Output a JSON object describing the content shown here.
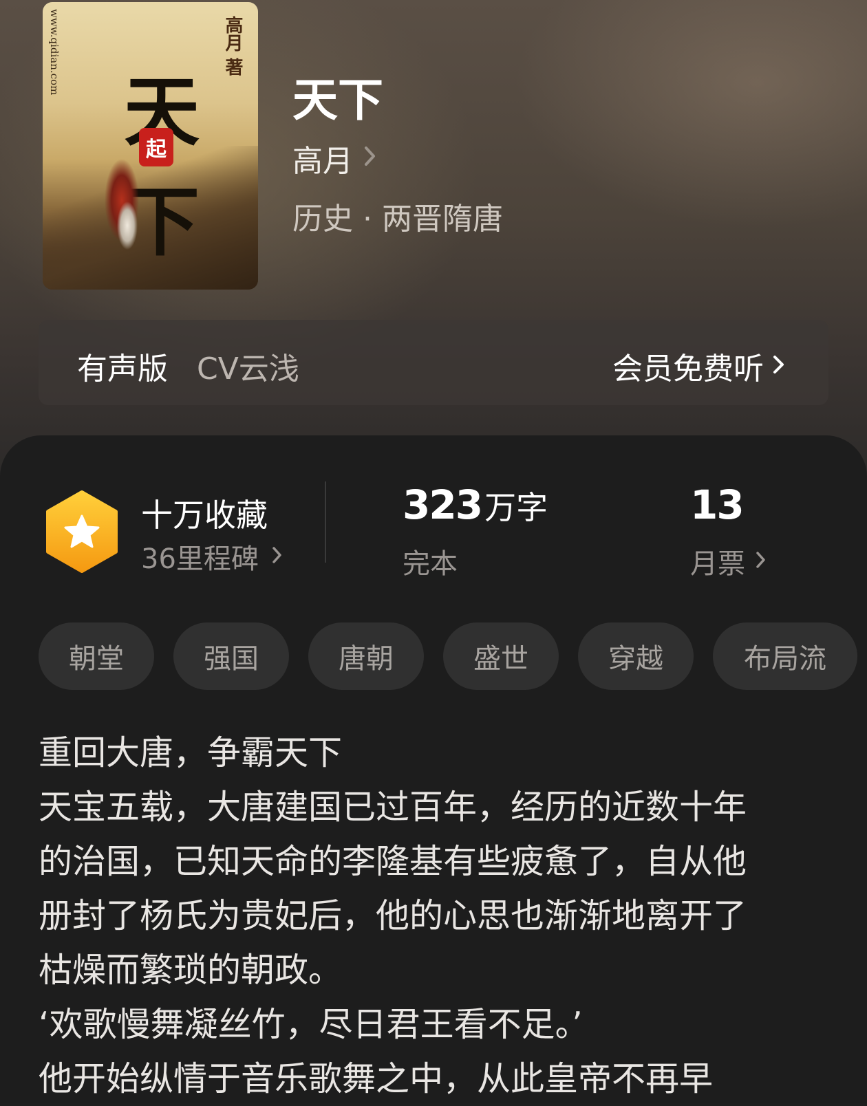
{
  "book": {
    "title": "天下",
    "author": "高月",
    "genre": "历史 · 两晋隋唐"
  },
  "cover": {
    "title": "天下",
    "author_signature": "高月 著",
    "seal": "起",
    "side_text": "www.qidian.com"
  },
  "audio": {
    "label": "有声版",
    "narrator": "CV云浅",
    "action": "会员免费听"
  },
  "stats": {
    "collect_title": "十万收藏",
    "milestone": "36里程碑",
    "word_count": "323",
    "word_unit": "万字",
    "status": "完本",
    "monthly_votes": "13",
    "monthly_votes_label": "月票"
  },
  "tags": [
    "朝堂",
    "强国",
    "唐朝",
    "盛世",
    "穿越",
    "布局流"
  ],
  "description": [
    "重回大唐，争霸天下",
    "天宝五载，大唐建国已过百年，经历的近数十年",
    "的治国，已知天命的李隆基有些疲惫了，自从他",
    "册封了杨氏为贵妃后，他的心思也渐渐地离开了",
    "枯燥而繁琐的朝政。",
    "‘欢歌慢舞凝丝竹，尽日君王看不足。’",
    "他开始纵情于音乐歌舞之中，从此皇帝不再早"
  ],
  "colors": {
    "badge_gold": "#f7b81e",
    "panel_bg": "#1d1d1d",
    "tag_bg": "#303030"
  },
  "icons": [
    "chevron-right-icon",
    "star-icon",
    "hexagon-badge-icon"
  ]
}
